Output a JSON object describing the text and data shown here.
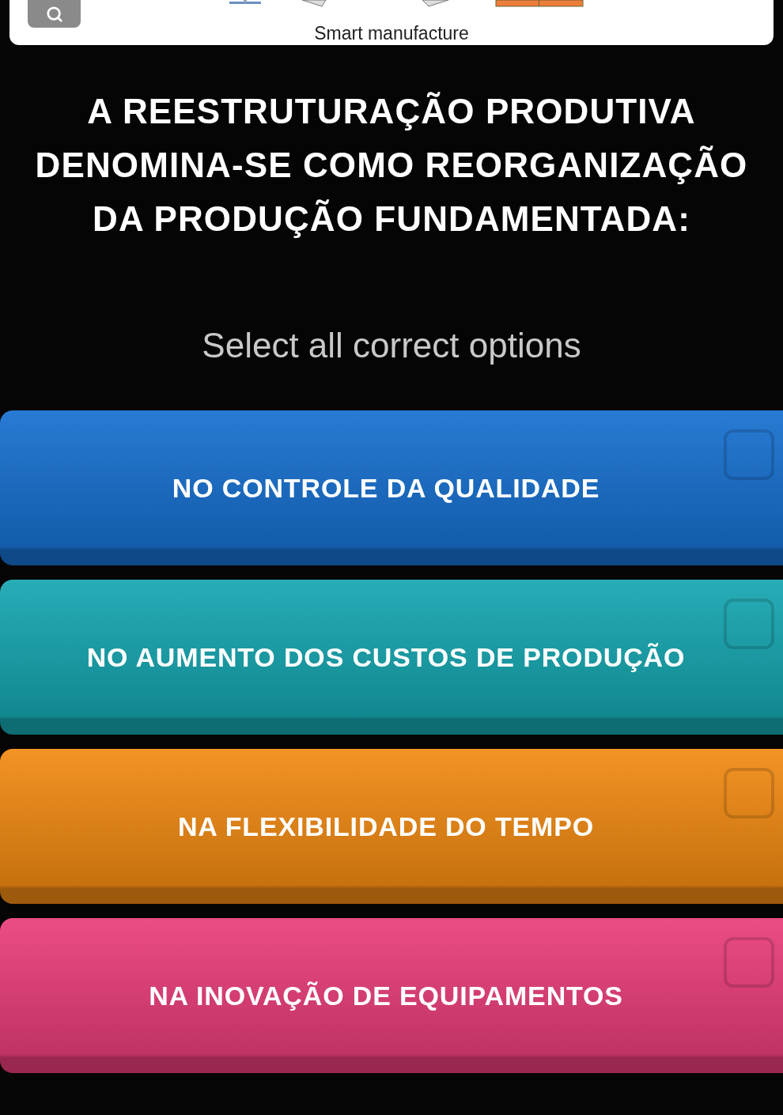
{
  "image_card": {
    "caption": "Smart manufacture"
  },
  "question": "A REESTRUTURAÇÃO PRODUTIVA DENOMINA-SE COMO REORGANIZAÇÃO DA PRODUÇÃO FUNDAMENTADA:",
  "instruction": "Select all correct options",
  "options": [
    {
      "label": "NO CONTROLE DA QUALIDADE",
      "color": "#1670d0",
      "checked": false
    },
    {
      "label": "NO AUMENTO DOS CUSTOS DE PRODUÇÃO",
      "color": "#15a6b0",
      "checked": false
    },
    {
      "label": "NA FLEXIBILIDADE DO TEMPO",
      "color": "#f28a12",
      "checked": false
    },
    {
      "label": "NA INOVAÇÃO DE EQUIPAMENTOS",
      "color": "#ea3d7a",
      "checked": false
    }
  ]
}
